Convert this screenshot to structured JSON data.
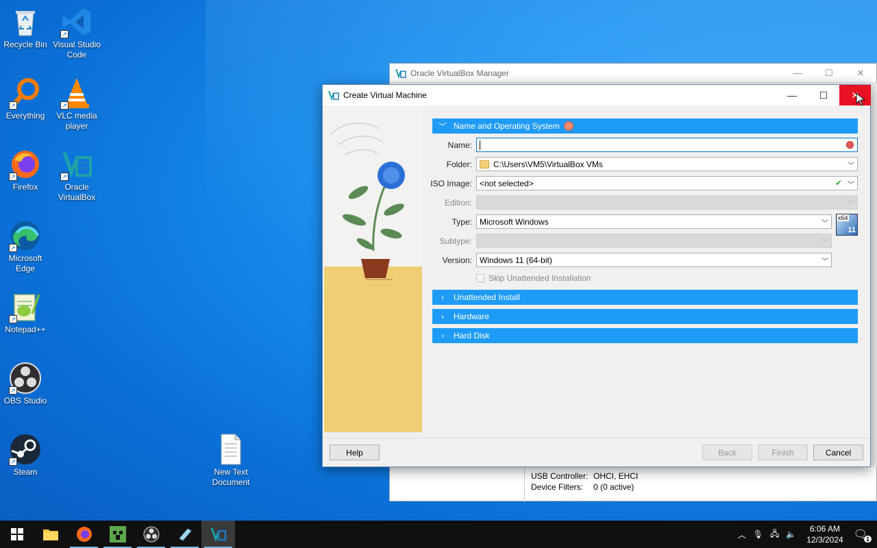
{
  "desktop": {
    "icons": [
      {
        "label": "Recycle Bin",
        "icon": "recycle-bin-icon"
      },
      {
        "label": "Visual Studio Code",
        "icon": "vscode-icon"
      },
      {
        "label": "Everything",
        "icon": "everything-search-icon"
      },
      {
        "label": "VLC media player",
        "icon": "vlc-icon"
      },
      {
        "label": "Firefox",
        "icon": "firefox-icon"
      },
      {
        "label": "Oracle VirtualBox",
        "icon": "virtualbox-icon"
      },
      {
        "label": "Microsoft Edge",
        "icon": "edge-icon"
      },
      {
        "label": "Notepad++",
        "icon": "notepadpp-icon"
      },
      {
        "label": "OBS Studio",
        "icon": "obs-icon"
      },
      {
        "label": "Steam",
        "icon": "steam-icon"
      },
      {
        "label": "New Text Document",
        "icon": "text-document-icon"
      }
    ]
  },
  "manager": {
    "title": "Oracle VirtualBox Manager",
    "usb_controller_label": "USB Controller:",
    "usb_controller_value": "OHCI, EHCI",
    "device_filters_label": "Device Filters:",
    "device_filters_value": "0 (0 active)"
  },
  "dialog": {
    "title": "Create Virtual Machine",
    "sections": {
      "name_os": "Name and Operating System",
      "unattended": "Unattended Install",
      "hardware": "Hardware",
      "hard_disk": "Hard Disk"
    },
    "fields": {
      "name_label": "Name:",
      "name_value": "",
      "folder_label": "Folder:",
      "folder_value": "C:\\Users\\VM5\\VirtualBox VMs",
      "iso_label": "ISO Image:",
      "iso_value": "<not selected>",
      "edition_label": "Edition:",
      "edition_value": "",
      "type_label": "Type:",
      "type_value": "Microsoft Windows",
      "subtype_label": "Subtype:",
      "subtype_value": "",
      "version_label": "Version:",
      "version_value": "Windows 11 (64-bit)",
      "skip_unattended_label": "Skip Unattended Installation",
      "os_badge_top": "x64",
      "os_badge_bottom": "11"
    },
    "buttons": {
      "help": "Help",
      "back": "Back",
      "finish": "Finish",
      "cancel": "Cancel"
    }
  },
  "taskbar": {
    "apps": [
      "start-icon",
      "file-explorer-icon",
      "firefox-icon",
      "minecraft-icon",
      "obs-icon",
      "notepad-icon",
      "virtualbox-icon"
    ],
    "time": "6:06 AM",
    "date": "12/3/2024",
    "notification_count": "1"
  },
  "colors": {
    "section_header": "#1e9bf6",
    "close_button": "#e81123",
    "desktop_bg": "#0a6fd6"
  }
}
